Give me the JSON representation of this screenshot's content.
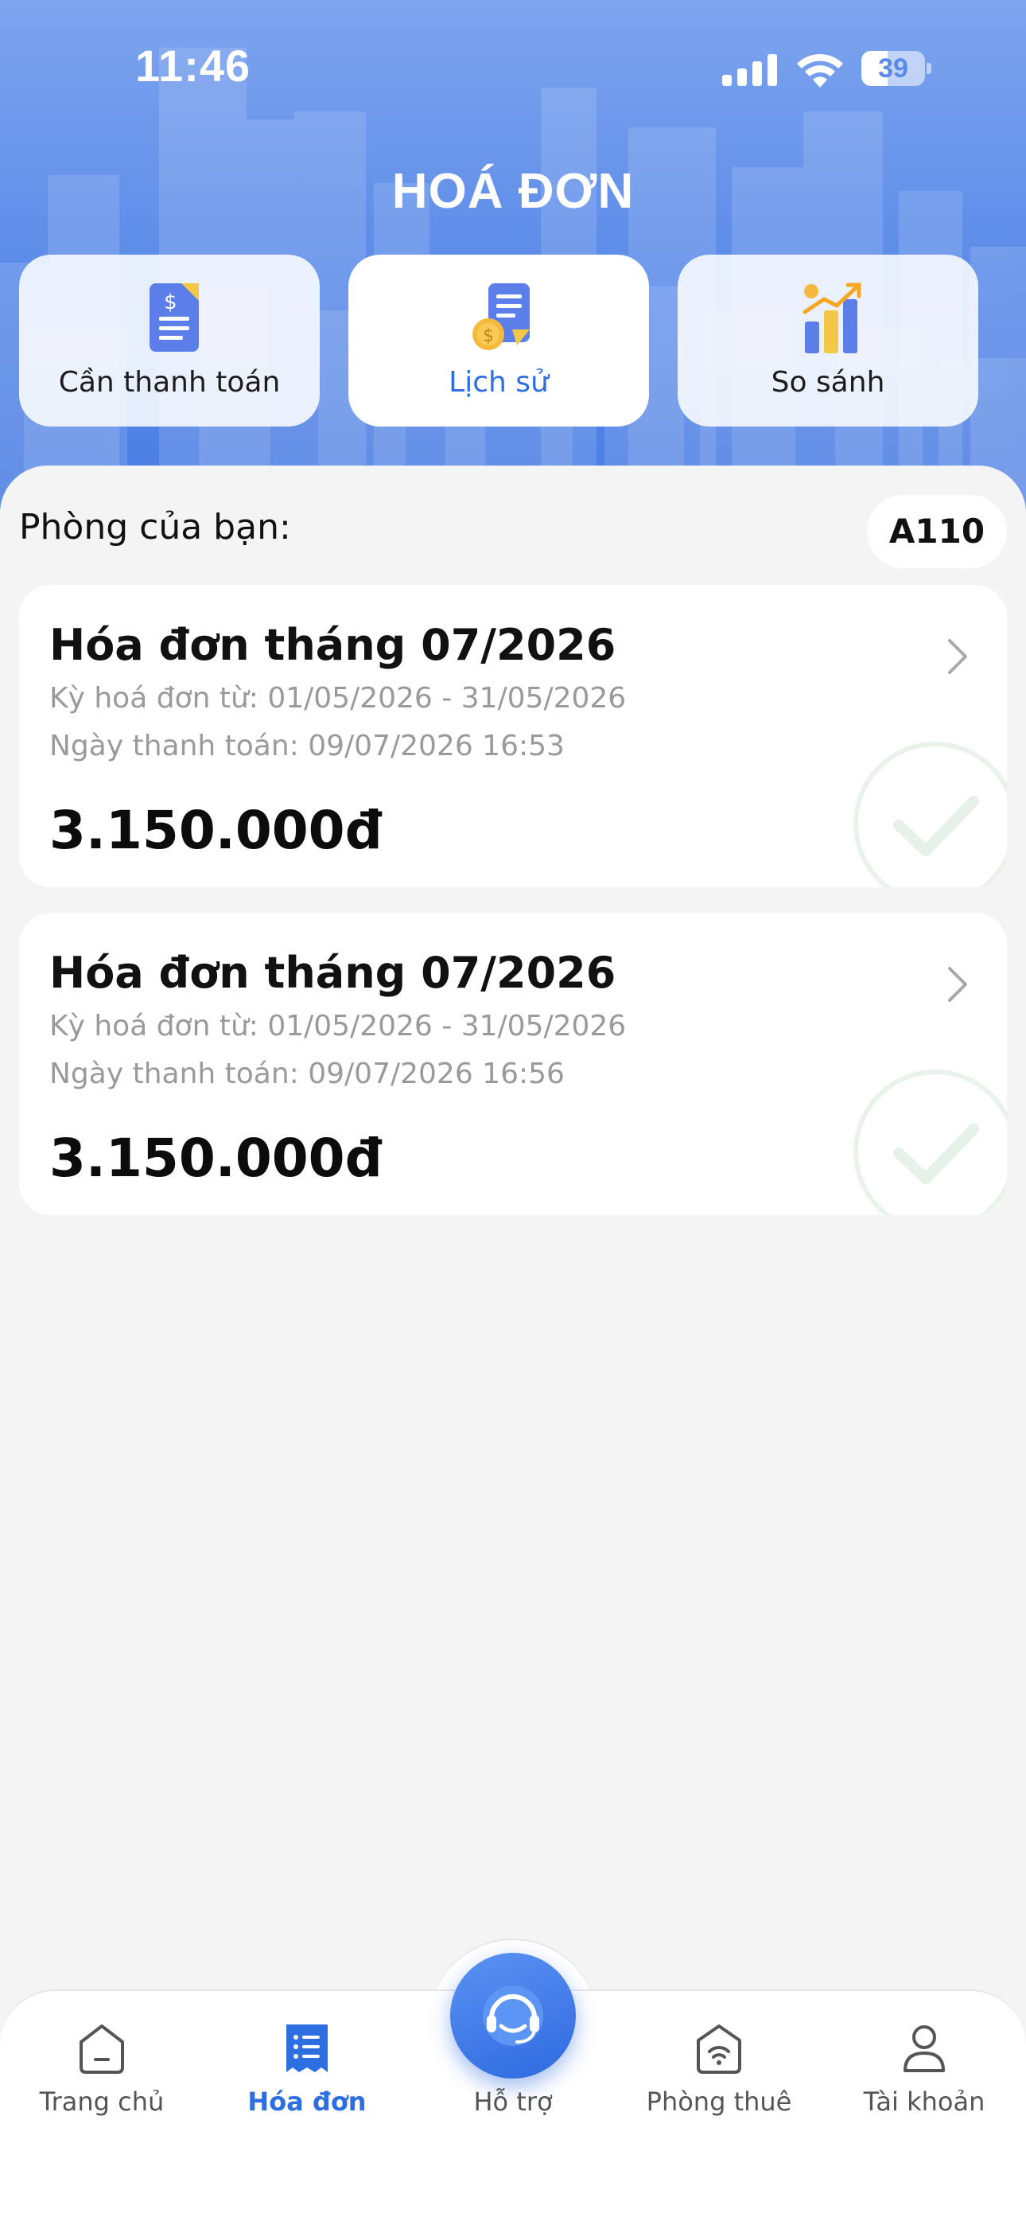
{
  "status_bar": {
    "time": "11:46",
    "battery": "39"
  },
  "header": {
    "title": "HOÁ ĐƠN"
  },
  "tabs": [
    {
      "label": "Cần thanh toán",
      "icon": "invoice-dollar-icon",
      "active": false
    },
    {
      "label": "Lịch sử",
      "icon": "invoice-history-icon",
      "active": true
    },
    {
      "label": "So sánh",
      "icon": "compare-chart-icon",
      "active": false
    }
  ],
  "room": {
    "label": "Phòng của bạn:",
    "code": "A110"
  },
  "invoices": [
    {
      "title": "Hóa đơn tháng 07/2026",
      "period": "Kỳ hoá đơn từ:  01/05/2026 - 31/05/2026",
      "paid": "Ngày thanh toán: 09/07/2026 16:53",
      "amount": "3.150.000đ",
      "status_icon": "paid-check-icon"
    },
    {
      "title": "Hóa đơn tháng 07/2026",
      "period": "Kỳ hoá đơn từ:  01/05/2026 - 31/05/2026",
      "paid": "Ngày thanh toán: 09/07/2026 16:56",
      "amount": "3.150.000đ",
      "status_icon": "paid-check-icon"
    }
  ],
  "nav": {
    "home": "Trang chủ",
    "invoices": "Hóa đơn",
    "support": "Hỗ trợ",
    "rental": "Phòng thuê",
    "account": "Tài khoản"
  },
  "colors": {
    "accent": "#2d6fe0",
    "header_top": "#7da4ee",
    "header_bottom": "#4a7de3",
    "background": "#f4f4f4"
  }
}
